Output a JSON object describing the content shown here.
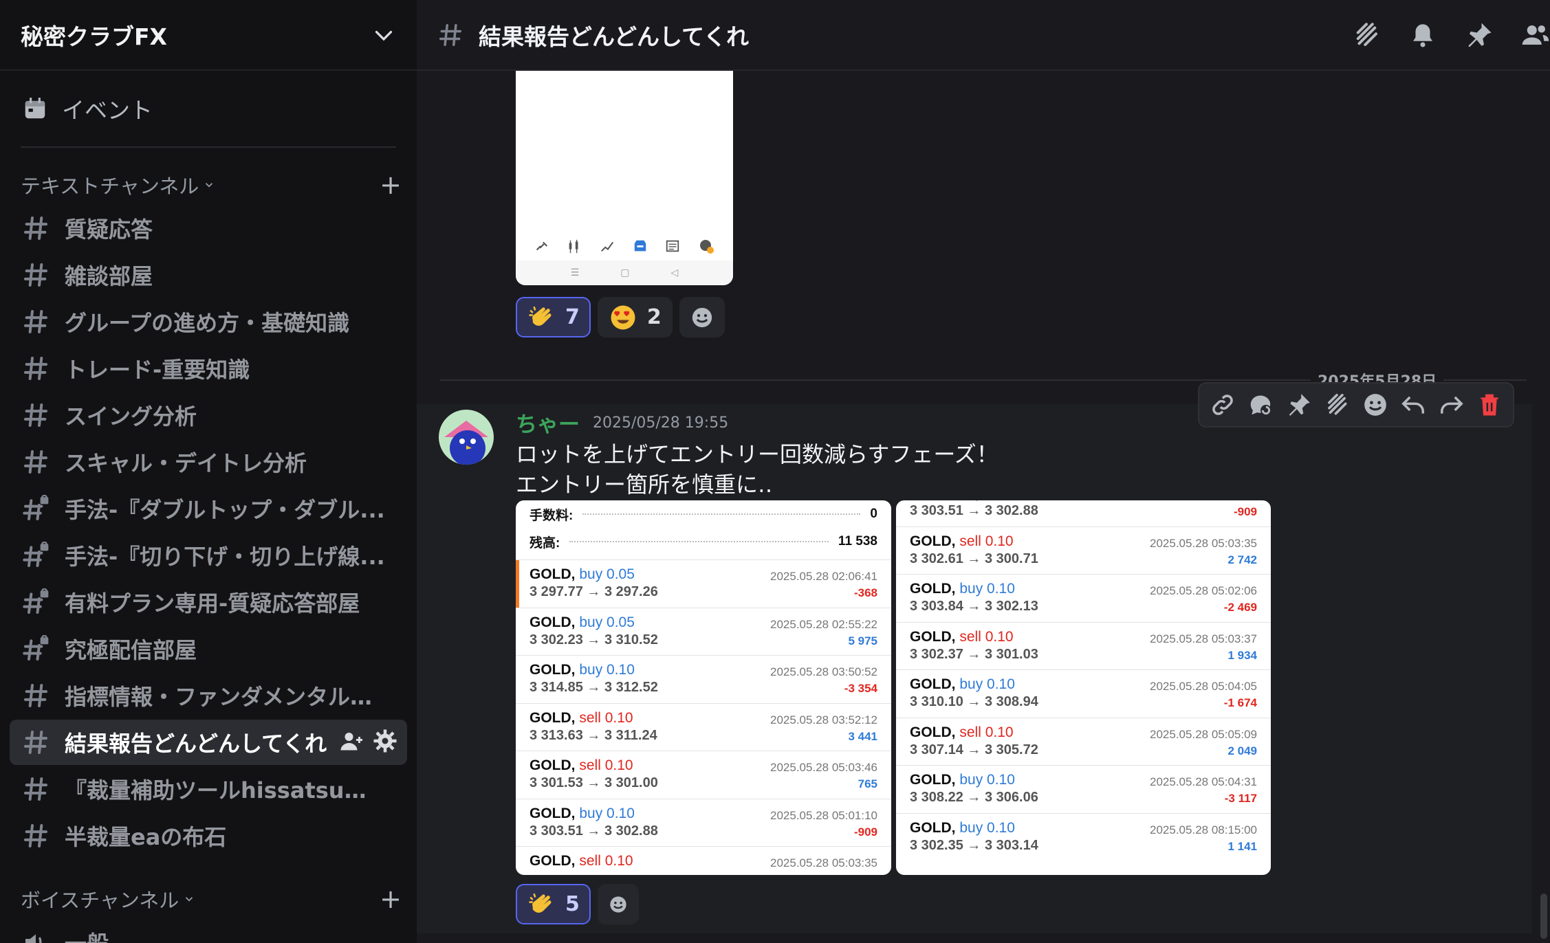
{
  "server": {
    "name": "秘密クラブFX"
  },
  "events": {
    "label": "イベント"
  },
  "categories": {
    "text": "テキストチャンネル",
    "voice": "ボイスチャンネル"
  },
  "channels": [
    {
      "name": "質疑応答",
      "locked": false
    },
    {
      "name": "雑談部屋",
      "locked": false
    },
    {
      "name": "グループの進め方・基礎知識",
      "locked": false
    },
    {
      "name": "トレード-重要知識",
      "locked": false
    },
    {
      "name": "スイング分析",
      "locked": false
    },
    {
      "name": "スキャル・デイトレ分析",
      "locked": false
    },
    {
      "name": "手法-『ダブルトップ・ダブル...",
      "locked": true
    },
    {
      "name": "手法-『切り下げ・切り上げ線...",
      "locked": true
    },
    {
      "name": "有料プラン専用-質疑応答部屋",
      "locked": true
    },
    {
      "name": "究極配信部屋",
      "locked": true
    },
    {
      "name": "指標情報・ファンダメンタル情...",
      "locked": false
    },
    {
      "name": "結果報告どんどんしてくれ",
      "locked": false,
      "active": true
    },
    {
      "name": "『裁量補助ツールhissatsu＆ツ...",
      "locked": false
    },
    {
      "name": "半裁量eaの布石",
      "locked": false
    }
  ],
  "voice_channels": [
    {
      "name": "一般"
    }
  ],
  "topbar": {
    "title": "結果報告どんどんしてくれ"
  },
  "reactions_top": [
    {
      "emoji": "clapping-hands",
      "count": "7",
      "mine": true
    },
    {
      "emoji": "heart-eyes",
      "count": "2",
      "mine": false
    }
  ],
  "date_divider": "2025年5月28日",
  "message": {
    "author": "ちゃー",
    "timestamp": "2025/05/28 19:55",
    "line1": "ロットを上げてエントリー回数減らすフェーズ！",
    "line2": "エントリー箇所を慎重に‥"
  },
  "reactions_bottom": [
    {
      "emoji": "clapping-hands",
      "count": "5",
      "mine": true
    }
  ],
  "shot_left": {
    "fee_label": "手数料:",
    "fee_value": "0",
    "balance_label": "残高:",
    "balance_value": "11 538",
    "trades": [
      {
        "sym": "GOLD,",
        "side": "buy",
        "lot": "0.05",
        "prices": "3 297.77 → 3 297.26",
        "dt": "2025.05.28 02:06:41",
        "pl": "-368",
        "hl": true
      },
      {
        "sym": "GOLD,",
        "side": "buy",
        "lot": "0.05",
        "prices": "3 302.23 → 3 310.52",
        "dt": "2025.05.28 02:55:22",
        "pl": "5 975"
      },
      {
        "sym": "GOLD,",
        "side": "buy",
        "lot": "0.10",
        "prices": "3 314.85 → 3 312.52",
        "dt": "2025.05.28 03:50:52",
        "pl": "-3 354"
      },
      {
        "sym": "GOLD,",
        "side": "sell",
        "lot": "0.10",
        "prices": "3 313.63 → 3 311.24",
        "dt": "2025.05.28 03:52:12",
        "pl": "3 441"
      },
      {
        "sym": "GOLD,",
        "side": "sell",
        "lot": "0.10",
        "prices": "3 301.53 → 3 301.00",
        "dt": "2025.05.28 05:03:46",
        "pl": "765"
      },
      {
        "sym": "GOLD,",
        "side": "buy",
        "lot": "0.10",
        "prices": "3 303.51 → 3 302.88",
        "dt": "2025.05.28 05:01:10",
        "pl": "-909"
      },
      {
        "sym": "GOLD,",
        "side": "sell",
        "lot": "0.10",
        "prices": "",
        "dt": "2025.05.28 05:03:35",
        "pl": ""
      }
    ]
  },
  "shot_right": {
    "trades": [
      {
        "sym": "GOLD,",
        "side": "buy",
        "lot": "0.10",
        "prices": "3 303.51 → 3 302.88",
        "dt": "2025.05.28 05:01:10",
        "pl": "-909"
      },
      {
        "sym": "GOLD,",
        "side": "sell",
        "lot": "0.10",
        "prices": "3 302.61 → 3 300.71",
        "dt": "2025.05.28 05:03:35",
        "pl": "2 742"
      },
      {
        "sym": "GOLD,",
        "side": "buy",
        "lot": "0.10",
        "prices": "3 303.84 → 3 302.13",
        "dt": "2025.05.28 05:02:06",
        "pl": "-2 469"
      },
      {
        "sym": "GOLD,",
        "side": "sell",
        "lot": "0.10",
        "prices": "3 302.37 → 3 301.03",
        "dt": "2025.05.28 05:03:37",
        "pl": "1 934"
      },
      {
        "sym": "GOLD,",
        "side": "buy",
        "lot": "0.10",
        "prices": "3 310.10 → 3 308.94",
        "dt": "2025.05.28 05:04:05",
        "pl": "-1 674"
      },
      {
        "sym": "GOLD,",
        "side": "sell",
        "lot": "0.10",
        "prices": "3 307.14 → 3 305.72",
        "dt": "2025.05.28 05:05:09",
        "pl": "2 049"
      },
      {
        "sym": "GOLD,",
        "side": "buy",
        "lot": "0.10",
        "prices": "3 308.22 → 3 306.06",
        "dt": "2025.05.28 05:04:31",
        "pl": "-3 117"
      },
      {
        "sym": "GOLD,",
        "side": "buy",
        "lot": "0.10",
        "prices": "3 302.35 → 3 303.14",
        "dt": "2025.05.28 08:15:00",
        "pl": "1 141"
      }
    ]
  },
  "colors": {
    "accent": "#5865f2",
    "author": "#3ba55c",
    "buy": "#2f7bd8",
    "sell": "#e0261f",
    "delete": "#f23f43"
  }
}
